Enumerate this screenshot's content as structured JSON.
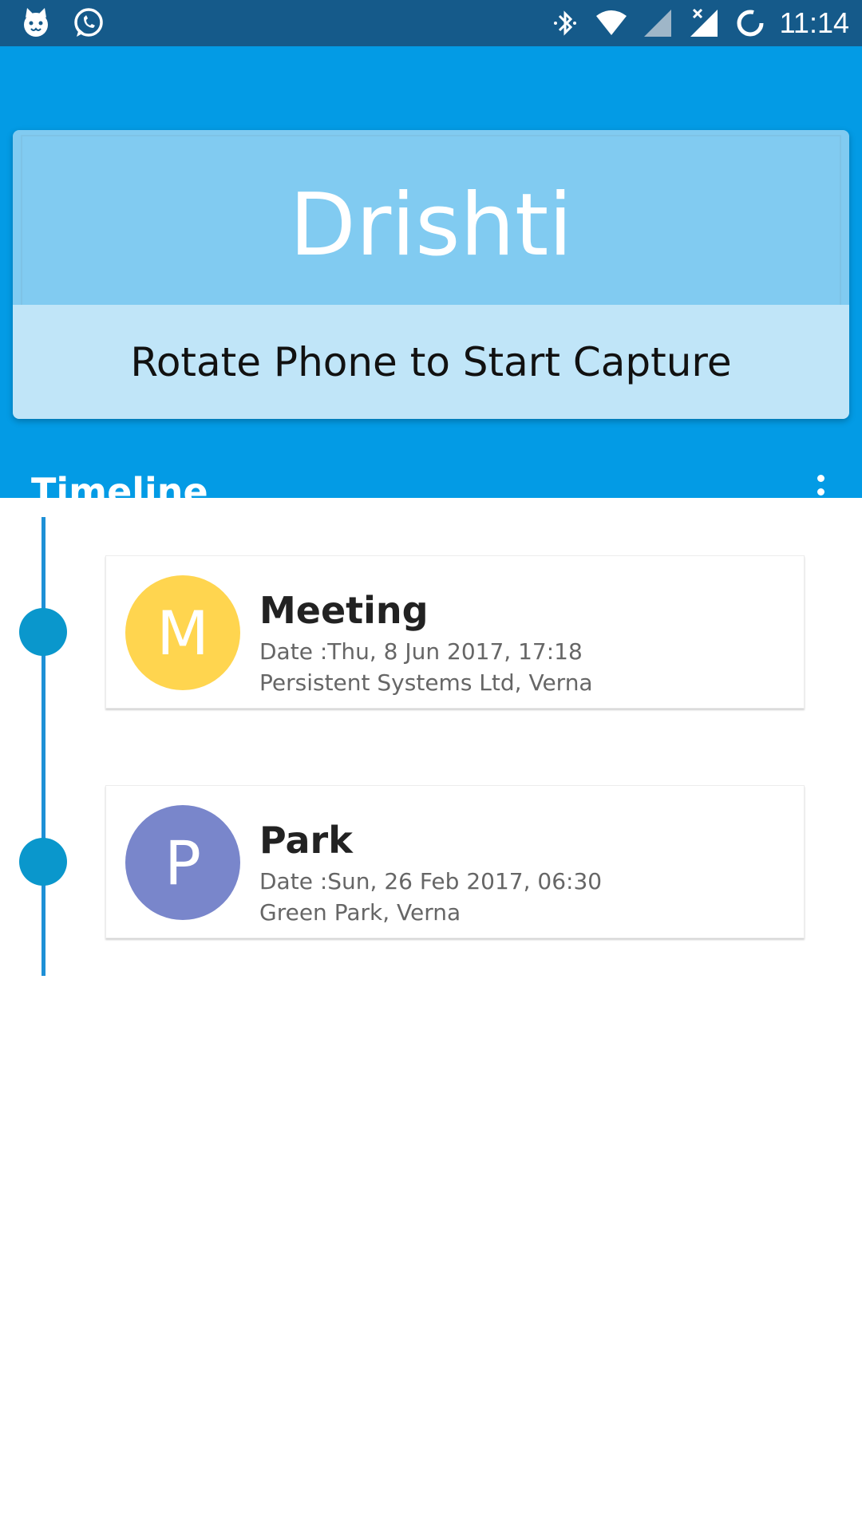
{
  "status_bar": {
    "time": "11:14",
    "left_icons": [
      "cat-app-icon",
      "whatsapp-icon"
    ],
    "right_icons": [
      "bluetooth-icon",
      "wifi-icon",
      "signal-icon",
      "no-signal-icon",
      "loading-icon"
    ]
  },
  "banner": {
    "title": "Drishti",
    "subtitle": "Rotate Phone to Start Capture"
  },
  "toolbar": {
    "title": "Timeline",
    "menu_icon": "overflow-menu-icon"
  },
  "events": [
    {
      "initial": "M",
      "title": "Meeting",
      "date": "Date :Thu, 8 Jun 2017, 17:18",
      "location": "Persistent Systems Ltd, Verna",
      "avatar_color": "#ffd54f"
    },
    {
      "initial": "P",
      "title": "Park",
      "date": "Date :Sun, 26 Feb 2017, 06:30",
      "location": "Green Park, Verna",
      "avatar_color": "#7986cb"
    }
  ],
  "colors": {
    "status_bar": "#155a8a",
    "header": "#039be5",
    "banner_top": "#81cbf1",
    "banner_bottom": "#c0e5f8",
    "timeline": "#1e90d6"
  }
}
